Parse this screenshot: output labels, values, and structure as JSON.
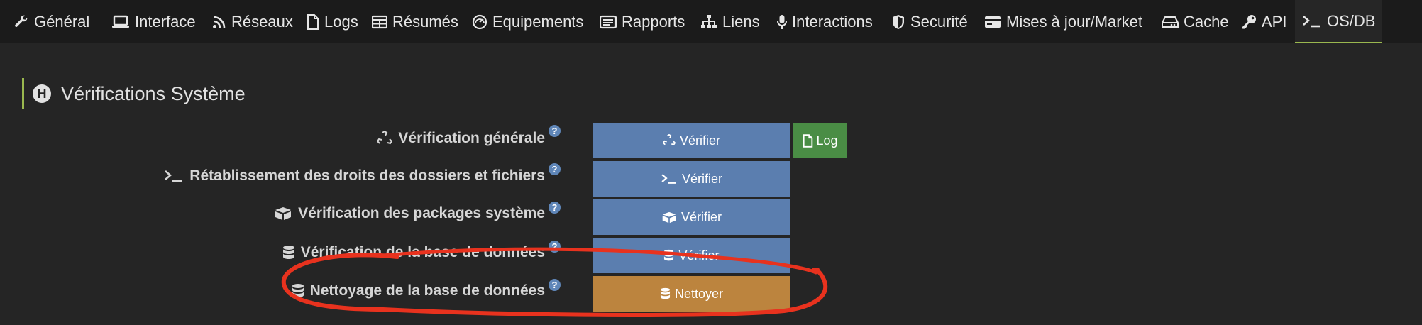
{
  "tabs": [
    {
      "label": "Général",
      "icon": "wrench-icon"
    },
    {
      "label": "Interface",
      "icon": "laptop-icon"
    },
    {
      "label": "Réseaux",
      "icon": "rss-icon"
    },
    {
      "label": "Logs",
      "icon": "file-icon"
    },
    {
      "label": "Résumés",
      "icon": "table-icon"
    },
    {
      "label": "Equipements",
      "icon": "gauge-icon"
    },
    {
      "label": "Rapports",
      "icon": "newspaper-icon"
    },
    {
      "label": "Liens",
      "icon": "sitemap-icon"
    },
    {
      "label": "Interactions",
      "icon": "microphone-icon"
    },
    {
      "label": "Securité",
      "icon": "shield-icon"
    },
    {
      "label": "Mises à jour/Market",
      "icon": "credit-card-icon"
    },
    {
      "label": "Cache",
      "icon": "hdd-icon"
    },
    {
      "label": "API",
      "icon": "key-icon"
    },
    {
      "label": "OS/DB",
      "icon": "terminal-icon",
      "active": true
    }
  ],
  "section": {
    "title": "Vérifications Système",
    "icon_letter": "H"
  },
  "rows": [
    {
      "label": "Vérification générale",
      "icon": "recycle-icon",
      "button": "Vérifier",
      "button_icon": "recycle-icon",
      "button_color": "#5b7eaf"
    },
    {
      "label": "Rétablissement des droits des dossiers et fichiers",
      "icon": "terminal-icon",
      "button": "Vérifier",
      "button_icon": "terminal-icon",
      "button_color": "#5b7eaf"
    },
    {
      "label": "Vérification des packages système",
      "icon": "boxes-icon",
      "button": "Vérifier",
      "button_icon": "boxes-icon",
      "button_color": "#5b7eaf"
    },
    {
      "label": "Vérification de la base de données",
      "icon": "database-icon",
      "button": "Vérifier",
      "button_icon": "database-icon",
      "button_color": "#5b7eaf"
    },
    {
      "label": "Nettoyage de la base de données",
      "icon": "database-icon",
      "button": "Nettoyer",
      "button_icon": "database-icon",
      "button_color": "#bc843e"
    }
  ],
  "help_mark": "?",
  "log_button": {
    "label": "Log",
    "icon": "file-icon",
    "color": "#4a8d45"
  },
  "colors": {
    "accent": "#9ab84f",
    "primary_button": "#5b7eaf",
    "warning_button": "#bc843e",
    "success_button": "#4a8d45",
    "annotation": "#e8321e"
  }
}
